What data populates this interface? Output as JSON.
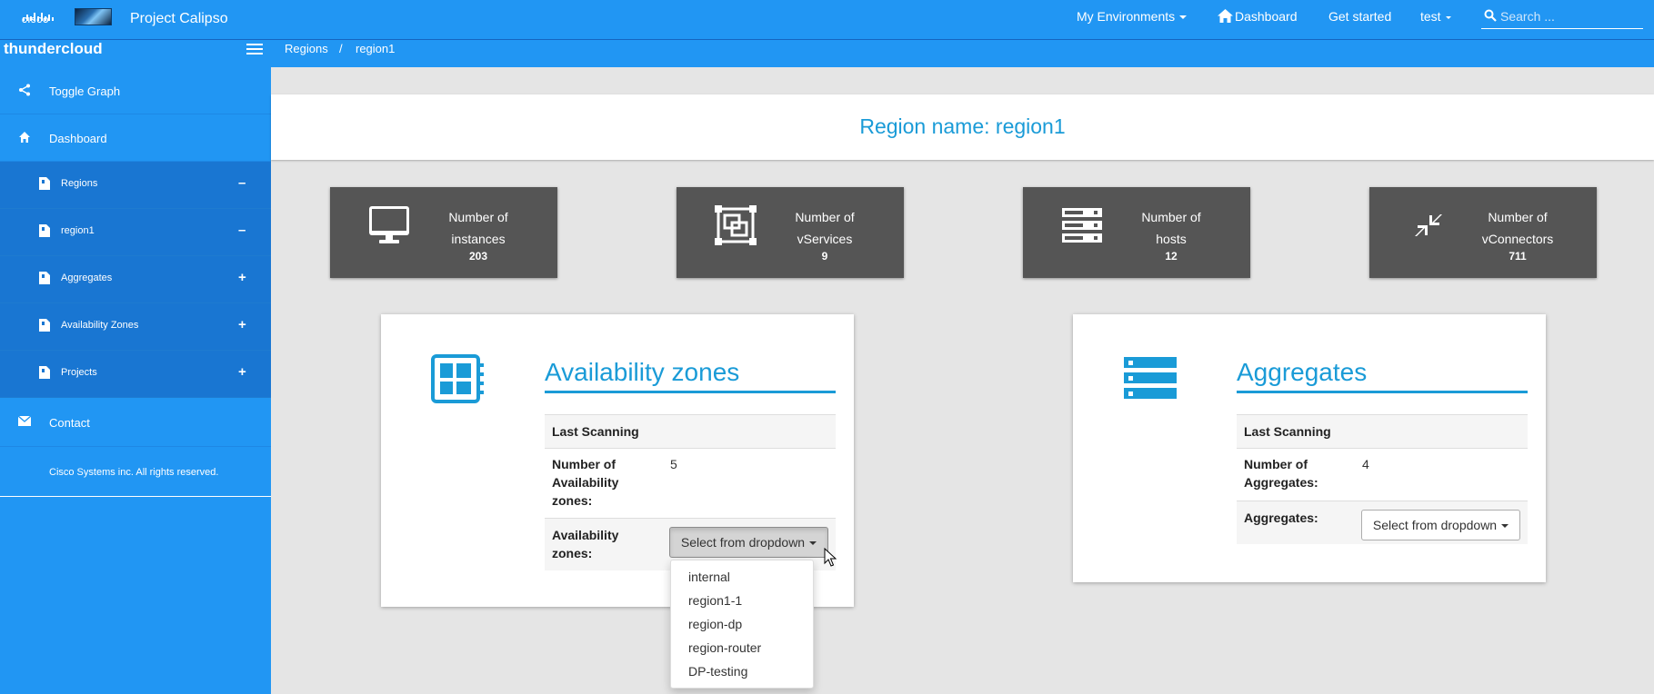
{
  "header": {
    "logo_text": "CISCO",
    "app_title": "Project Calipso",
    "nav": {
      "environments": "My Environments",
      "dashboard": "Dashboard",
      "get_started": "Get started",
      "user": "test"
    },
    "search": {
      "placeholder": "Search ...",
      "value": ""
    }
  },
  "sidebar": {
    "brand": "thundercloud",
    "items": [
      {
        "label": "Toggle Graph",
        "icon": "share-icon"
      },
      {
        "label": "Dashboard",
        "icon": "home-icon"
      },
      {
        "label": "Regions",
        "icon": "document-icon",
        "toggle": "–"
      },
      {
        "label": "region1",
        "icon": "document-icon",
        "toggle": "–"
      },
      {
        "label": "Aggregates",
        "icon": "document-icon",
        "toggle": "+"
      },
      {
        "label": "Availability Zones",
        "icon": "document-icon",
        "toggle": "+"
      },
      {
        "label": "Projects",
        "icon": "document-icon",
        "toggle": "+"
      },
      {
        "label": "Contact",
        "icon": "envelope-icon"
      }
    ],
    "footer": "Cisco Systems inc. All rights reserved."
  },
  "breadcrumb": {
    "items": [
      "Regions",
      "/",
      "region1"
    ]
  },
  "page": {
    "title": "Region name: region1"
  },
  "stats": [
    {
      "label_line1": "Number of",
      "label_line2": "instances",
      "value": "203",
      "icon": "monitor-icon"
    },
    {
      "label_line1": "Number of",
      "label_line2": "vServices",
      "value": "9",
      "icon": "vservice-icon"
    },
    {
      "label_line1": "Number of",
      "label_line2": "hosts",
      "value": "12",
      "icon": "server-icon"
    },
    {
      "label_line1": "Number of",
      "label_line2": "vConnectors",
      "value": "711",
      "icon": "compress-icon"
    }
  ],
  "az_card": {
    "title": "Availability zones",
    "last_scanning": "Last Scanning",
    "count_label_1": "Number of",
    "count_label_2": "Availability",
    "count_label_3": "zones:",
    "count_value": "5",
    "select_label_1": "Availability",
    "select_label_2": "zones:",
    "dropdown_label": "Select from dropdown",
    "options": [
      "internal",
      "region1-1",
      "region-dp",
      "region-router",
      "DP-testing"
    ]
  },
  "agg_card": {
    "title": "Aggregates",
    "last_scanning": "Last Scanning",
    "count_label_1": "Number of",
    "count_label_2": "Aggregates:",
    "count_value": "4",
    "select_label": "Aggregates:",
    "dropdown_label": "Select from dropdown"
  },
  "colors": {
    "primary": "#2196f3",
    "accent": "#1a9bd7",
    "tile": "#555555"
  }
}
